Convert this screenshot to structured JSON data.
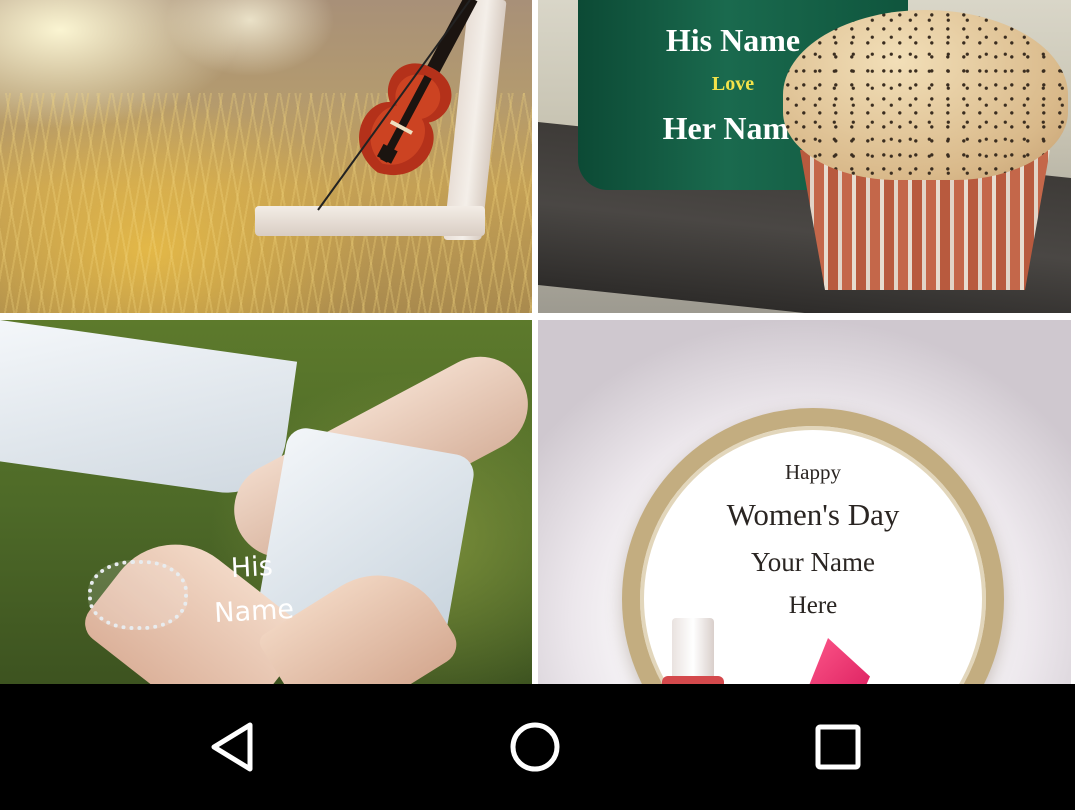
{
  "gallery": {
    "tiles": [
      {
        "id": "violin-bench",
        "text": []
      },
      {
        "id": "mug-muffin",
        "text": [
          "His Name",
          "Love",
          "Her Name"
        ]
      },
      {
        "id": "hands-heart",
        "text": [
          "His",
          "Name"
        ]
      },
      {
        "id": "womens-day",
        "text": [
          "Happy",
          "Women's Day",
          "Your Name",
          "Here"
        ]
      }
    ]
  },
  "navbar": {
    "back_icon": "back-triangle-icon",
    "home_icon": "home-circle-icon",
    "recents_icon": "recents-square-icon",
    "icon_color": "#ffffff",
    "background": "#000000"
  }
}
